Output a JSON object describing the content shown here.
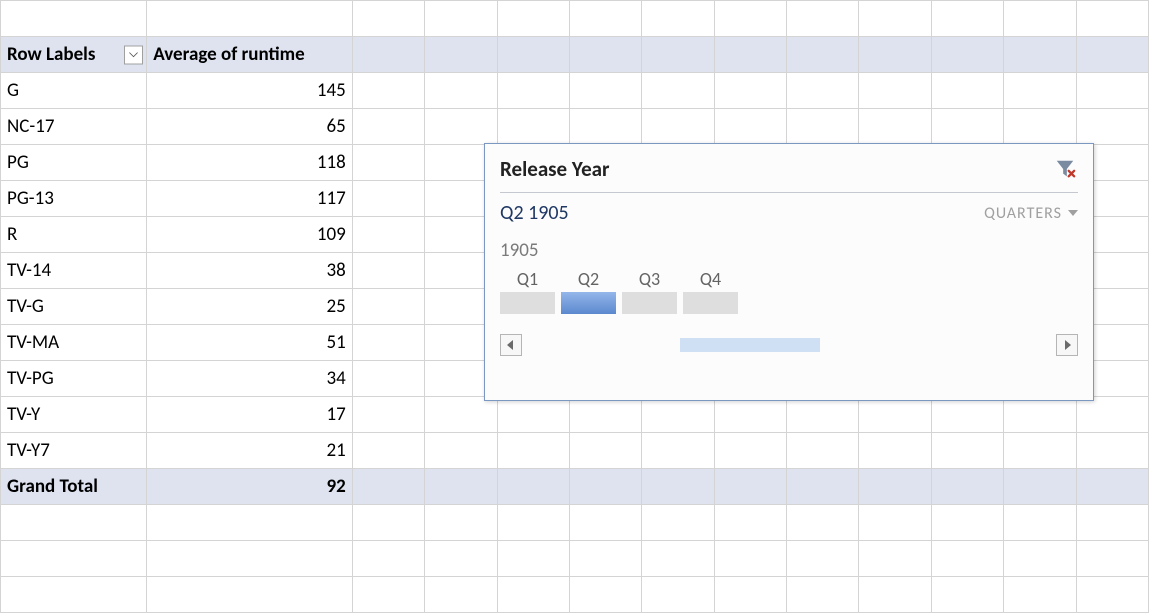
{
  "pivot": {
    "headers": {
      "rowLabels": "Row Labels",
      "values": "Average of runtime"
    },
    "rows": [
      {
        "label": "G",
        "value": "145"
      },
      {
        "label": "NC-17",
        "value": "65"
      },
      {
        "label": "PG",
        "value": "118"
      },
      {
        "label": "PG-13",
        "value": "117"
      },
      {
        "label": "R",
        "value": "109"
      },
      {
        "label": "TV-14",
        "value": "38"
      },
      {
        "label": "TV-G",
        "value": "25"
      },
      {
        "label": "TV-MA",
        "value": "51"
      },
      {
        "label": "TV-PG",
        "value": "34"
      },
      {
        "label": "TV-Y",
        "value": "17"
      },
      {
        "label": "TV-Y7",
        "value": "21"
      }
    ],
    "total": {
      "label": "Grand Total",
      "value": "92"
    }
  },
  "timeline": {
    "title": "Release Year",
    "period": "Q2 1905",
    "levelLabel": "QUARTERS",
    "year": "1905",
    "quarters": [
      {
        "label": "Q1",
        "selected": false
      },
      {
        "label": "Q2",
        "selected": true
      },
      {
        "label": "Q3",
        "selected": false
      },
      {
        "label": "Q4",
        "selected": false
      }
    ]
  }
}
